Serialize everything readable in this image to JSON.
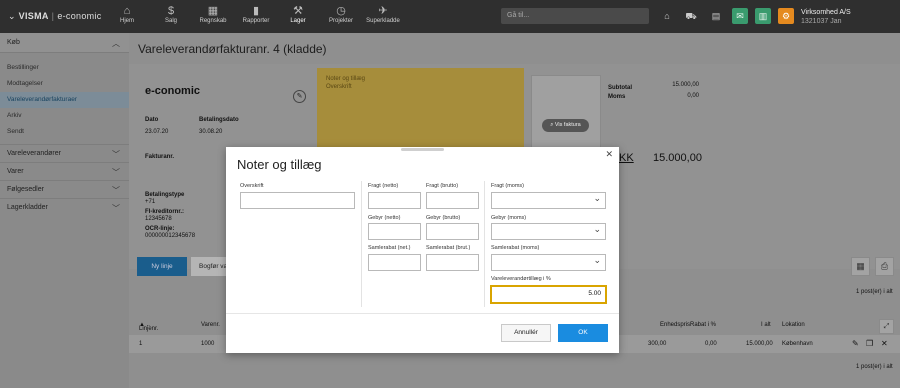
{
  "topbar": {
    "logo_brand": "VISMA",
    "logo_product": "e-conomic",
    "nav": [
      {
        "label": "Hjem",
        "icon": "home-icon",
        "glyph": "⌂"
      },
      {
        "label": "Salg",
        "icon": "dollar-icon",
        "glyph": "$"
      },
      {
        "label": "Regnskab",
        "icon": "calculator-icon",
        "glyph": "▦"
      },
      {
        "label": "Rapporter",
        "icon": "bar-chart-icon",
        "glyph": "▮"
      },
      {
        "label": "Lager",
        "icon": "tools-icon",
        "glyph": "⚒"
      },
      {
        "label": "Projekter",
        "icon": "clock-icon",
        "glyph": "◷"
      },
      {
        "label": "Superkladde",
        "icon": "rocket-icon",
        "glyph": "✈"
      }
    ],
    "search_placeholder": "Gå til...",
    "company": "Virksomhed A/S",
    "company_id": "1321037 Jan"
  },
  "sidebar": {
    "section": "Køb",
    "items": [
      "Bestillinger",
      "Modtagelser",
      "Vareleverandørfakturaer",
      "Arkiv",
      "Sendt"
    ],
    "groups": [
      "Vareleverandører",
      "Varer",
      "Følgesedler",
      "Lagerkladder"
    ]
  },
  "page": {
    "title": "Vareleverandørfakturanr. 4 (kladde)",
    "company_name": "e-conomic",
    "date_label": "Dato",
    "date": "23.07.20",
    "due_label": "Betalingsdato",
    "due": "30.08.20",
    "invoice_no_label": "Fakturanr.",
    "pay_type_label": "Betalingstype",
    "pay_type": "+71",
    "fi_label": "FI-kreditornr.:",
    "fi": "12345678",
    "ocr_label": "OCR-linje:",
    "ocr": "000000012345678",
    "notes_title": "Noter og tillæg",
    "notes_sub": "Overskrift",
    "see_invoice": "Vis faktura",
    "subtotal_label": "Subtotal",
    "subtotal": "15.000,00",
    "vat_label": "Moms",
    "vat": "0,00",
    "currency": "KK",
    "total": "15.000,00",
    "new_line": "Ny linje",
    "book": "Bogfør var",
    "post_count": "1 post(er) i alt"
  },
  "table": {
    "headers": [
      "Linjenr.",
      "Varenr.",
      "Enhedspris",
      "Rabat i %",
      "I alt",
      "Lokation"
    ],
    "row": {
      "line": "1",
      "item": "1000",
      "unit_price": "300,00",
      "discount": "0,00",
      "total": "15.000,00",
      "location": "København"
    }
  },
  "modal": {
    "title": "Noter og tillæg",
    "heading_label": "Overskrift",
    "freight_net": "Fragt (netto)",
    "freight_gross": "Fragt (brutto)",
    "freight_vat": "Fragt (moms)",
    "fee_net": "Gebyr (netto)",
    "fee_gross": "Gebyr (brutto)",
    "fee_vat": "Gebyr (moms)",
    "disc_net": "Samlerabat (net.)",
    "disc_gross": "Samlerabat (brut.)",
    "disc_vat": "Samlerabat (moms)",
    "supplier_fee_label": "Vareleverandørtillæg i %",
    "supplier_fee_value": "5.00",
    "cancel": "Annullér",
    "ok": "OK"
  }
}
